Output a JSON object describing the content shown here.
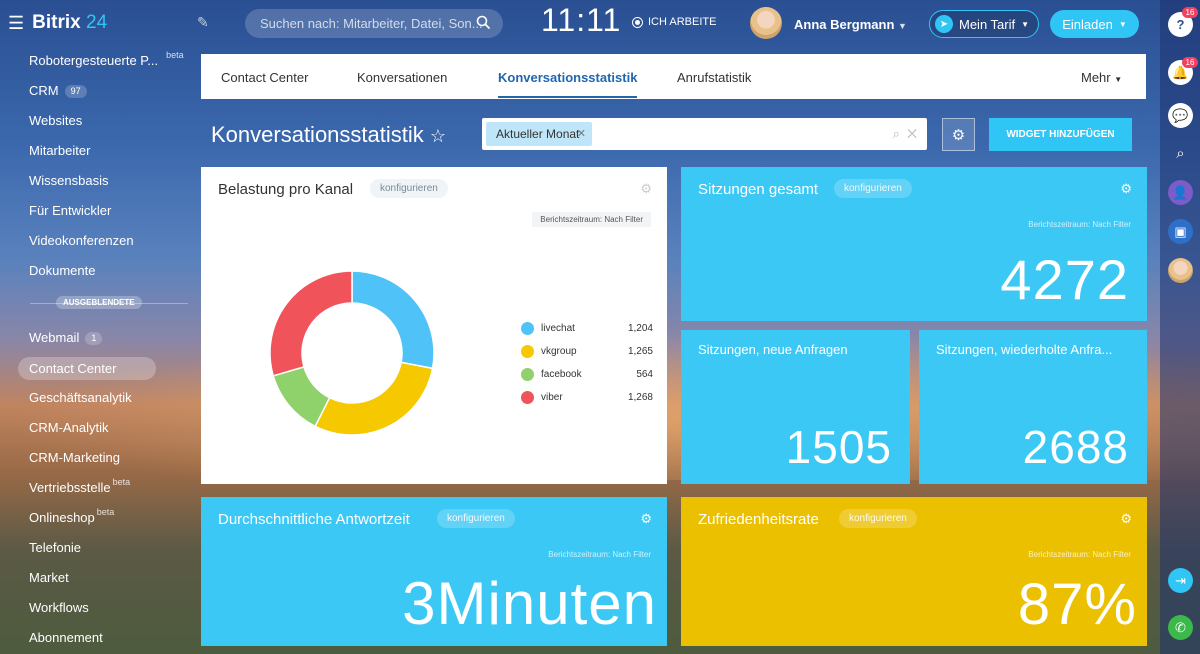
{
  "header": {
    "logo_name": "Bitrix",
    "logo_num": "24",
    "search_placeholder": "Suchen nach: Mitarbeiter, Datei, Son...",
    "clock": "11:11",
    "work_status": "ICH ARBEITE",
    "user_name": "Anna Bergmann",
    "tarif_label": "Mein Tarif",
    "invite_label": "Einladen"
  },
  "sidebar": {
    "items": [
      {
        "label": "Robotergesteuerte P...",
        "sup": "beta"
      },
      {
        "label": "CRM",
        "count": "97"
      },
      {
        "label": "Websites"
      },
      {
        "label": "Mitarbeiter"
      },
      {
        "label": "Wissensbasis"
      },
      {
        "label": "Für Entwickler"
      },
      {
        "label": "Videokonferenzen"
      },
      {
        "label": "Dokumente"
      }
    ],
    "hidden_label": "AUSGEBLENDETE",
    "hidden_items": [
      {
        "label": "Webmail",
        "count": "1"
      },
      {
        "label": "Contact Center"
      },
      {
        "label": "Geschäftsanalytik"
      },
      {
        "label": "CRM-Analytik"
      },
      {
        "label": "CRM-Marketing"
      },
      {
        "label": "Vertriebsstelle",
        "sup": "beta"
      },
      {
        "label": "Onlineshop",
        "sup": "beta"
      },
      {
        "label": "Telefonie"
      },
      {
        "label": "Market"
      },
      {
        "label": "Workflows"
      },
      {
        "label": "Abonnement"
      }
    ]
  },
  "tabs": [
    "Contact Center",
    "Konversationen",
    "Konversationsstatistik",
    "Anrufstatistik"
  ],
  "tabs_more": "Mehr",
  "page": {
    "title": "Konversationsstatistik",
    "filter_chip": "Aktueller Monat",
    "add_widget": "WIDGET HINZUFÜGEN"
  },
  "widgets": {
    "configure": "konfigurieren",
    "period": "Berichtszeitraum: Nach Filter",
    "channel_load": {
      "title": "Belastung pro Kanal"
    },
    "total_sessions": {
      "title": "Sitzungen gesamt",
      "value": "4272"
    },
    "new_sessions": {
      "title": "Sitzungen, neue Anfragen",
      "value": "1505"
    },
    "repeat_sessions": {
      "title": "Sitzungen, wiederholte Anfra...",
      "value": "2688"
    },
    "avg_response": {
      "title": "Durchschnittliche Antwortzeit",
      "value": "3Minuten"
    },
    "satisfaction": {
      "title": "Zufriedenheitsrate",
      "value": "87%"
    }
  },
  "rail": {
    "badge_help": "16",
    "badge_notif": "16"
  },
  "colors": {
    "accent": "#2fc6f6",
    "blue_widget": "#3bc8f5",
    "yellow_widget": "#ebc000",
    "tab_active": "#2067b0"
  },
  "chart_data": {
    "type": "pie",
    "categories": [
      "livechat",
      "vkgroup",
      "facebook",
      "viber"
    ],
    "labels": [
      "1,204",
      "1,265",
      "564",
      "1,268"
    ],
    "values": [
      1204,
      1265,
      564,
      1268
    ],
    "colors": [
      "#4fc3f7",
      "#f5c800",
      "#8fd16a",
      "#f0535a"
    ]
  }
}
